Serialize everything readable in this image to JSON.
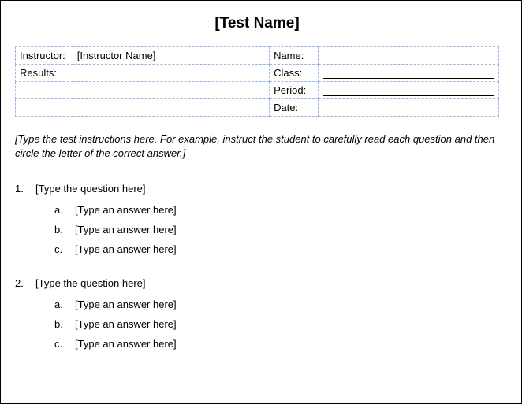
{
  "title": "[Test Name]",
  "info": {
    "instructor_label": "Instructor:",
    "instructor_value": "[Instructor Name]",
    "results_label": "Results:",
    "results_value": "",
    "name_label": "Name:",
    "class_label": "Class:",
    "period_label": "Period:",
    "date_label": "Date:"
  },
  "instructions": "[Type the test instructions here.  For example, instruct the student to carefully read each question and then circle the letter of the correct answer.]",
  "questions": [
    {
      "num": "1.",
      "text": "[Type the question here]",
      "answers": [
        {
          "letter": "a.",
          "text": "[Type an answer here]"
        },
        {
          "letter": "b.",
          "text": "[Type an answer here]"
        },
        {
          "letter": "c.",
          "text": "[Type an answer here]"
        }
      ]
    },
    {
      "num": "2.",
      "text": "[Type the question here]",
      "answers": [
        {
          "letter": "a.",
          "text": "[Type an answer here]"
        },
        {
          "letter": "b.",
          "text": "[Type an answer here]"
        },
        {
          "letter": "c.",
          "text": "[Type an answer here]"
        }
      ]
    }
  ]
}
